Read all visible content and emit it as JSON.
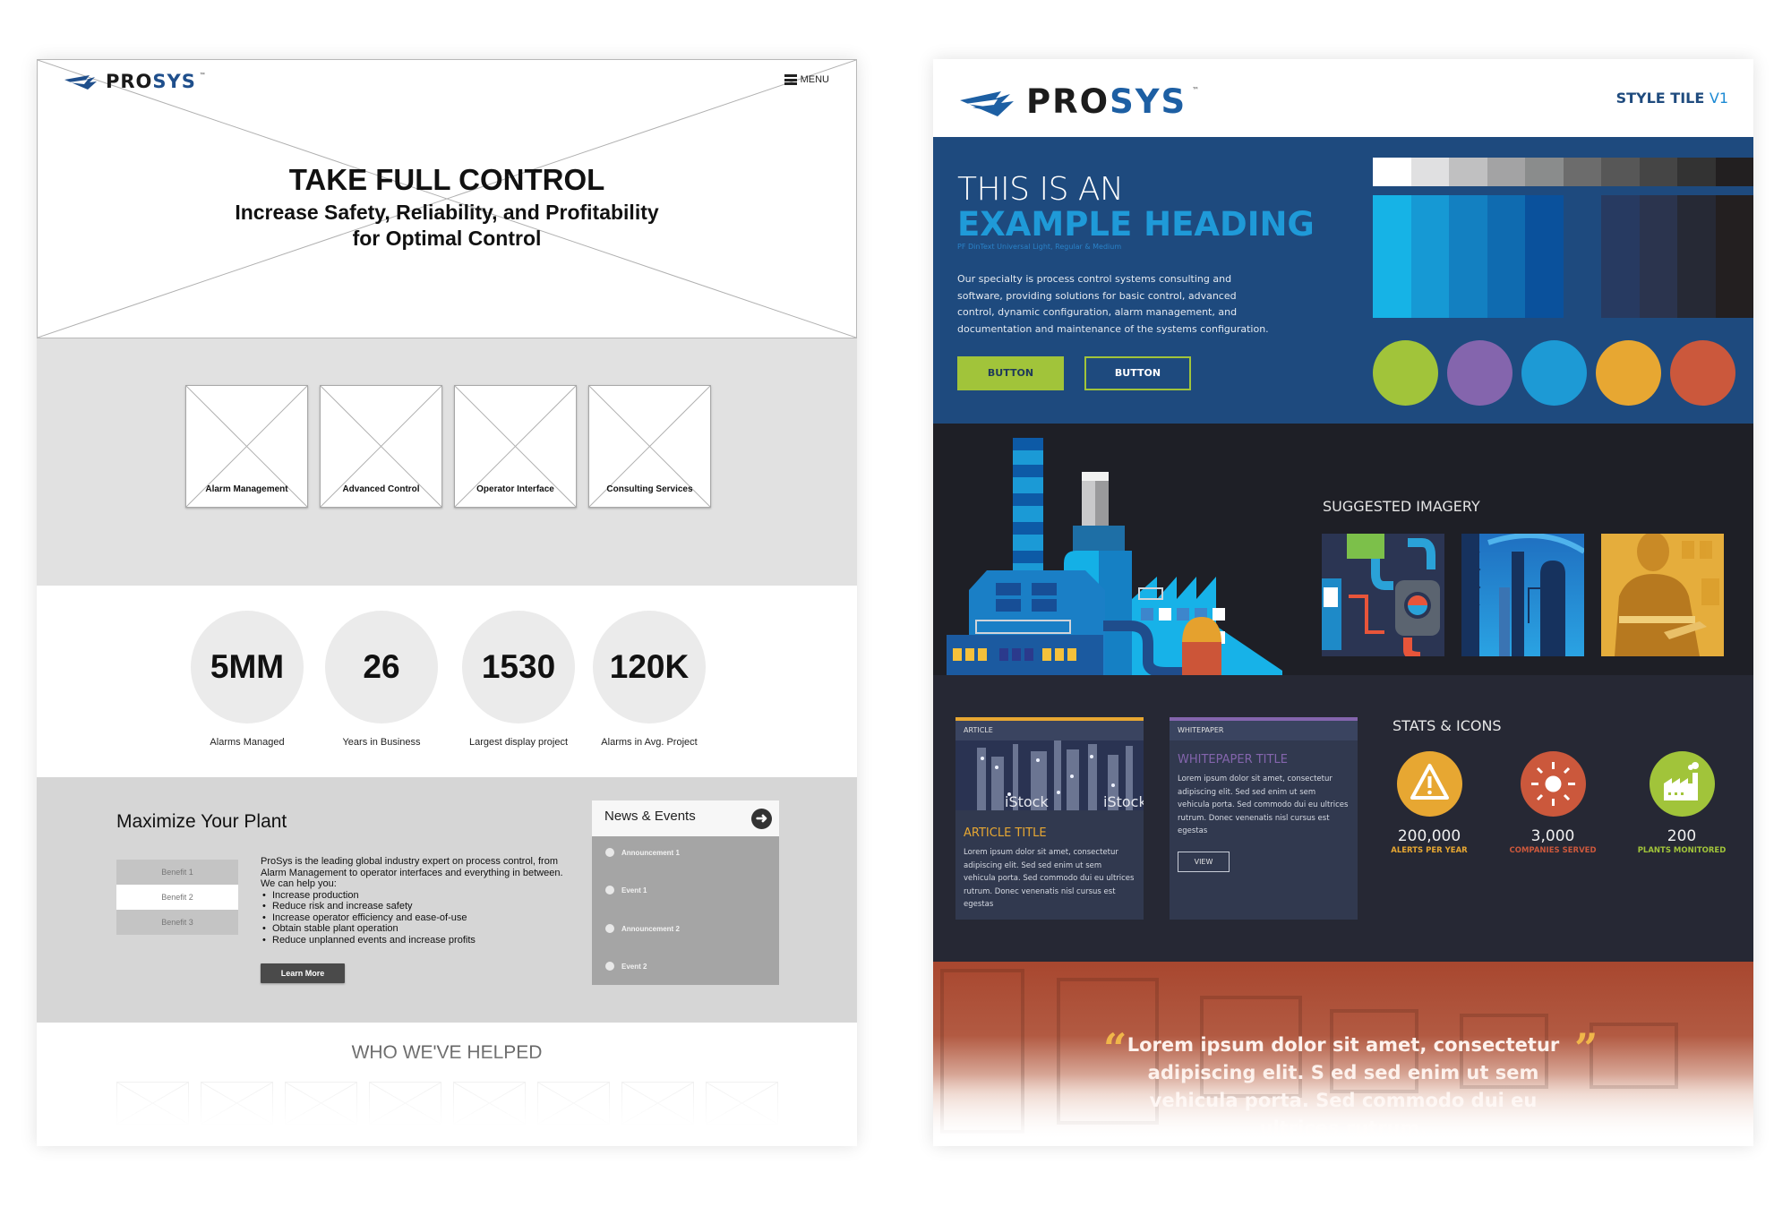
{
  "wireframe": {
    "logo": {
      "pro": "PRO",
      "sys": "SYS",
      "tm": "™"
    },
    "menu_label": "MENU",
    "hero": {
      "title": "TAKE FULL CONTROL",
      "subtitle_line1": "Increase Safety, Reliability, and Profitability",
      "subtitle_line2": "for Optimal Control"
    },
    "services": [
      {
        "label": "Alarm Management"
      },
      {
        "label": "Advanced Control"
      },
      {
        "label": "Operator Interface"
      },
      {
        "label": "Consulting Services"
      }
    ],
    "stats": [
      {
        "value": "5MM",
        "label": "Alarms Managed"
      },
      {
        "value": "26",
        "label": "Years in Business"
      },
      {
        "value": "1530",
        "label": "Largest display project"
      },
      {
        "value": "120K",
        "label": "Alarms in Avg. Project"
      }
    ],
    "plant": {
      "title": "Maximize Your Plant",
      "benefits": [
        "Benefit 1",
        "Benefit 2",
        "Benefit 3"
      ],
      "active_benefit": "Benefit 2",
      "intro": "ProSys is the leading global industry expert on process control, from Alarm Management to operator interfaces and everything in between. We can help you:",
      "bullets": [
        "Increase production",
        "Reduce risk and increase safety",
        "Increase operator efficiency and ease-of-use",
        "Obtain stable plant operation",
        "Reduce unplanned events and increase profits"
      ],
      "cta": "Learn More"
    },
    "news": {
      "title": "News & Events",
      "items": [
        "Announcement 1",
        "Event 1",
        "Announcement 2",
        "Event 2"
      ]
    },
    "helped": {
      "title": "WHO WE'VE HELPED",
      "logo_count": 8
    }
  },
  "style_tile": {
    "logo": {
      "pro": "PRO",
      "sys": "SYS",
      "tm": "™"
    },
    "version_label": "STYLE TILE",
    "version_num": "V1",
    "heading_line1": "THIS IS AN",
    "heading_line2": "EXAMPLE HEADING",
    "font_note": "PF DinText Universal Light, Regular & Medium",
    "paragraph": "Our specialty is process control systems consulting and software, providing solutions for basic control, advanced control, dynamic configuration, alarm management, and documentation and maintenance of the systems configuration.",
    "button_primary": "BUTTON",
    "button_secondary": "BUTTON",
    "palette": {
      "grays": [
        "#ffffff",
        "#e0e0e1",
        "#c0c0c1",
        "#a3a3a4",
        "#8a8c8c",
        "#6c6c6c",
        "#575757",
        "#454545",
        "#333333",
        "#221f20"
      ],
      "blues": [
        "#16b3e6",
        "#1699d4",
        "#1380c1",
        "#0f6bb0",
        "#0a519c",
        "#1e4a7e",
        "#273a61",
        "#2b344e",
        "#262935",
        "#231f20"
      ],
      "accents": [
        "#a1c43a",
        "#8465ad",
        "#1d9ad5",
        "#e7a732",
        "#cb583c"
      ]
    },
    "suggested_imagery_title": "SUGGESTED IMAGERY",
    "article": {
      "tag": "ARTICLE",
      "title": "ARTICLE TITLE",
      "body": "Lorem ipsum dolor sit amet, consectetur adipiscing elit. Sed sed enim ut sem vehicula porta. Sed commodo dui eu ultrices rutrum. Donec venenatis nisl cursus est egestas",
      "watermark": "iStock",
      "accent": "#e7a732"
    },
    "whitepaper": {
      "tag": "WHITEPAPER",
      "title": "WHITEPAPER TITLE",
      "body": "Lorem ipsum dolor sit amet, consectetur adipiscing elit. Sed sed enim ut sem vehicula porta. Sed commodo dui eu ultrices rutrum. Donec venenatis nisl cursus est egestas",
      "button": "VIEW",
      "accent": "#8465ad"
    },
    "stats_title": "STATS & ICONS",
    "stats": [
      {
        "icon": "warning-icon",
        "value": "200,000",
        "caption": "ALERTS PER YEAR",
        "color": "#e7a732"
      },
      {
        "icon": "sun-icon",
        "value": "3,000",
        "caption": "COMPANIES SERVED",
        "color": "#cb583c"
      },
      {
        "icon": "factory-icon",
        "value": "200",
        "caption": "PLANTS MONITORED",
        "color": "#a1c43a"
      }
    ],
    "quote": {
      "open": "“",
      "close": "”",
      "text": "Lorem ipsum dolor sit amet, consectetur adipiscing elit. S ed sed enim ut sem vehicula porta. Sed commodo dui eu ultrices rutrum."
    }
  }
}
